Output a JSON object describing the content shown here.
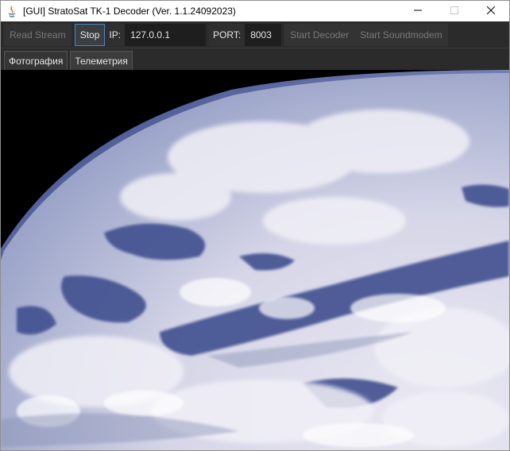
{
  "window": {
    "title": "[GUI] StratoSat TK-1 Decoder (Ver. 1.1.24092023)",
    "controls": {
      "minimize_icon": "minimize-icon",
      "maximize_icon": "maximize-icon",
      "close_icon": "close-icon"
    }
  },
  "toolbar": {
    "read_stream_label": "Read Stream",
    "stop_label": "Stop",
    "ip_label": "IP:",
    "ip_value": "127.0.0.1",
    "port_label": "PORT:",
    "port_value": "8003",
    "start_decoder_label": "Start Decoder",
    "start_soundmodem_label": "Start Soundmodem"
  },
  "tabs": [
    {
      "label": "Фотография",
      "selected": true
    },
    {
      "label": "Телеметрия",
      "selected": false
    }
  ],
  "colors": {
    "background": "#2b2b2b",
    "accent_border": "#4a88c7",
    "disabled_text": "#7a7a7a",
    "space": "#000000",
    "ocean": "#3f4f8f",
    "clouds": "#e4e3ef"
  }
}
